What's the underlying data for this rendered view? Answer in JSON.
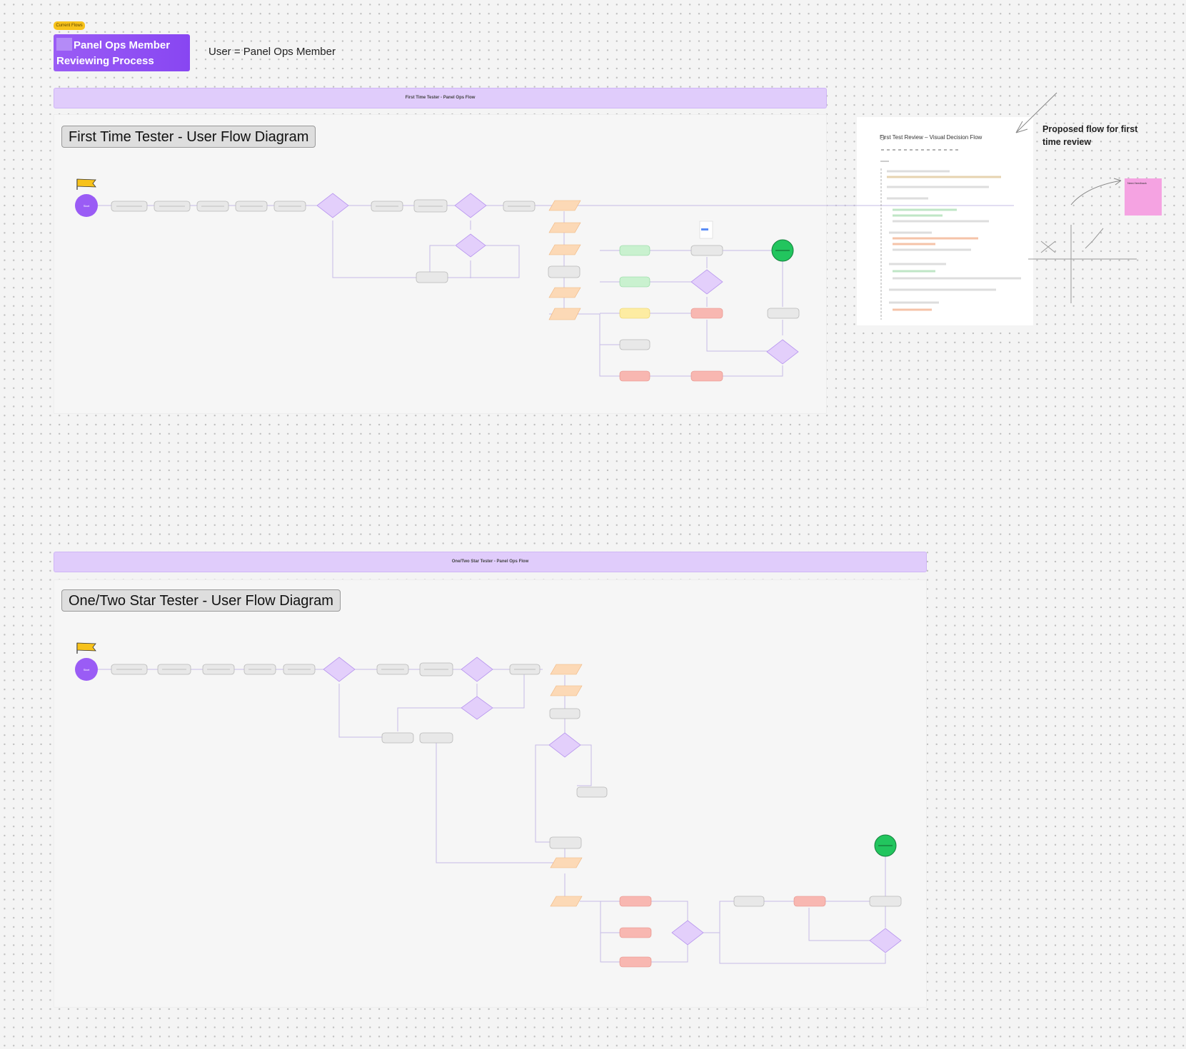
{
  "header": {
    "tag": "Current Flows",
    "title": "Panel Ops Member Reviewing Process",
    "user_label": "User = Panel Ops Member"
  },
  "flow1": {
    "banner": "First Time Tester - Panel Ops Flow",
    "heading": "First Time Tester - User Flow Diagram",
    "start_label": "Start"
  },
  "flow2": {
    "banner": "One/Two Star Tester - Panel Ops Flow",
    "heading": "One/Two Star Tester - User Flow Diagram",
    "start_label": "Start"
  },
  "side": {
    "doc_title": "First Test Review – Visual Decision Flow",
    "proposed_note": "Proposed flow for first time review"
  },
  "colors": {
    "purple_header": "#8c4cf2",
    "banner": "#e0ccfb",
    "start_node": "#9a5cf5",
    "end_node": "#22c55e",
    "decision": "#e3cffb",
    "process": "#e8e8e8",
    "input": "#fcd9b6",
    "green_box": "#c9f1cf",
    "yellow_box": "#fdeca2",
    "red_box": "#f8b7b1",
    "sticky": "#f5a3e2"
  }
}
